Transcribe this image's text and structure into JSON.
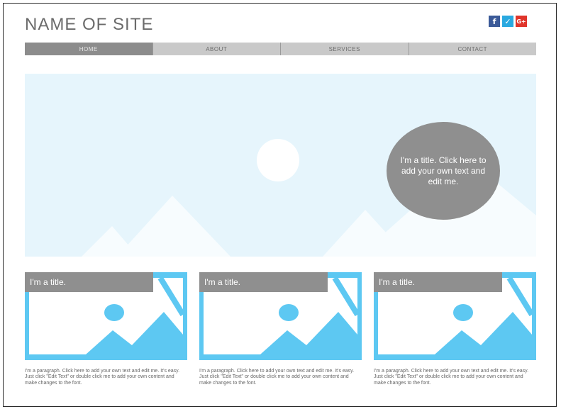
{
  "header": {
    "site_name": "NAME OF SITE"
  },
  "social": [
    {
      "icon": "facebook-icon",
      "glyph": "f"
    },
    {
      "icon": "twitter-icon",
      "glyph": "✓"
    },
    {
      "icon": "google-plus-icon",
      "glyph": "G+"
    }
  ],
  "nav": {
    "items": [
      "HOME",
      "ABOUT",
      "SERVICES",
      "CONTACT"
    ]
  },
  "hero": {
    "bubble_text": "I'm a title. Click here to add your own text and edit me."
  },
  "cards": [
    {
      "title": "I'm a title.",
      "paragraph": "I'm a paragraph. Click here to add your own text and edit me. It's easy. Just click \"Edit Text\" or double click me to add your own content and make changes to the font."
    },
    {
      "title": "I'm a title.",
      "paragraph": "I'm a paragraph. Click here to add your own text and edit me. It's easy. Just click \"Edit Text\" or double click me to add your own content and make changes to the font."
    },
    {
      "title": "I'm a title.",
      "paragraph": "I'm a paragraph. Click here to add your own text and edit me. It's easy. Just click \"Edit Text\" or double click me to add your own content and make changes to the font."
    }
  ],
  "colors": {
    "accent": "#5dc8f2",
    "hero_bg": "#e6f5fc",
    "nav_bg": "#c9c9c9",
    "nav_active": "#8c8c8c",
    "bubble": "#8f8f8f"
  }
}
